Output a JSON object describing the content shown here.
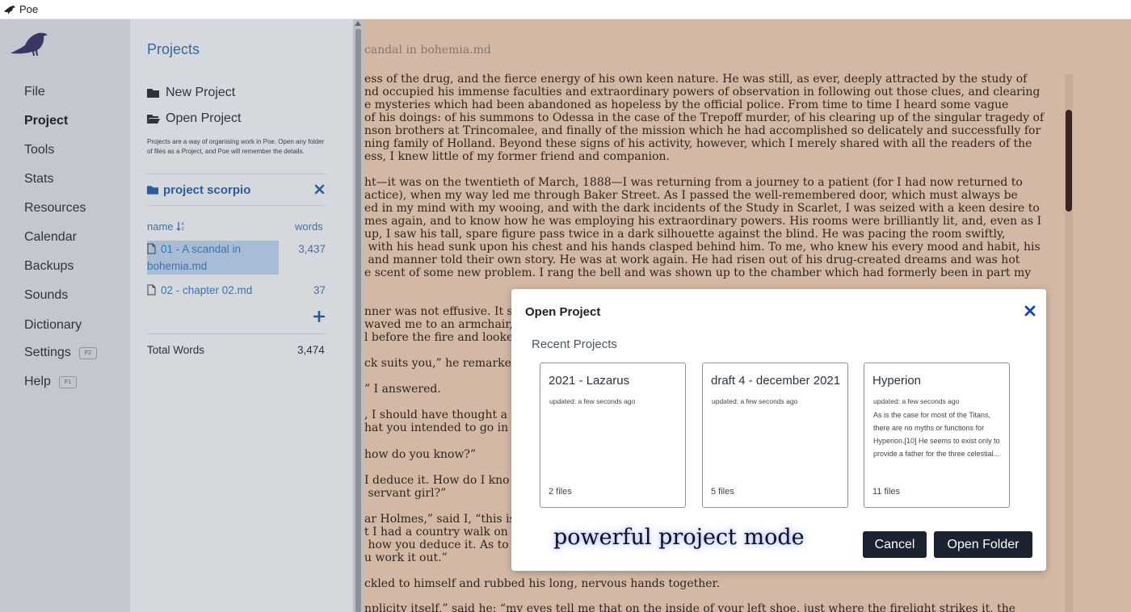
{
  "window": {
    "title": "Poe"
  },
  "nav": {
    "items": [
      {
        "label": "File"
      },
      {
        "label": "Project",
        "active": true
      },
      {
        "label": "Tools"
      },
      {
        "label": "Stats"
      },
      {
        "label": "Resources"
      },
      {
        "label": "Calendar"
      },
      {
        "label": "Backups"
      },
      {
        "label": "Sounds"
      },
      {
        "label": "Dictionary"
      },
      {
        "label": "Settings",
        "shortcut": "F2"
      },
      {
        "label": "Help",
        "shortcut": "F1"
      }
    ]
  },
  "projects_panel": {
    "title": "Projects",
    "new_project": "New Project",
    "open_project": "Open Project",
    "description": "Projects are a way of organising work in Poe. Open any folder of files as a Project, and Poe will remember the details.",
    "current_project": "project scorpio",
    "col_name": "name",
    "col_words": "words",
    "files": [
      {
        "name": "01 - A scandal in bohemia.md",
        "words": "3,437",
        "selected": true
      },
      {
        "name": "02 - chapter 02.md",
        "words": "37"
      }
    ],
    "total_label": "Total Words",
    "total_value": "3,474"
  },
  "editor": {
    "doc_title": "candal in bohemia.md",
    "para1": [
      "ess of the drug, and the fierce energy of his own keen nature. He was still, as ever, deeply attracted by the study of",
      "nd occupied his immense faculties and extraordinary powers of observation in following out those clues, and clearing",
      "e mysteries which had been abandoned as hopeless by the official police. From time to time I heard some vague",
      "of his doings: of his summons to Odessa in the case of the Trepoff murder, of his clearing up of the singular tragedy of",
      "nson brothers at Trincomalee, and finally of the mission which he had accomplished so delicately and successfully for",
      "ning family of Holland. Beyond these signs of his activity, however, which I merely shared with all the readers of the",
      "ess, I knew little of my former friend and companion."
    ],
    "para2": [
      "ht—it was on the twentieth of March, 1888—I was returning from a journey to a patient (for I had now returned to",
      "actice), when my way led me through Baker Street. As I passed the well-remembered door, which must always be",
      "ed in my mind with my wooing, and with the dark incidents of the Study in Scarlet, I was seized with a keen desire to",
      "mes again, and to know how he was employing his extraordinary powers. His rooms were brilliantly lit, and, even as I",
      "up, I saw his tall, spare figure pass twice in a dark silhouette against the blind. He was pacing the room swiftly,",
      " with his head sunk upon his chest and his hands clasped behind him. To me, who knew his every mood and habit, his",
      " and manner told their own story. He was at work again. He had risen out of his drug-created dreams and was hot",
      "e scent of some new problem. I rang the bell and was shown up to the chamber which had formerly been in part my"
    ],
    "para3": [
      "nner was not effusive. It se",
      "waved me to an armchair,",
      "l before the fire and looke"
    ],
    "para4": "ck suits you,” he remarke",
    "para5": "” I answered.",
    "para6": [
      ", I should have thought a",
      "hat you intended to go in"
    ],
    "para7": "how do you know?”",
    "para8": [
      "I deduce it. How do I kno",
      " servant girl?”"
    ],
    "para9": [
      "ar Holmes,” said I, “this is",
      "t I had a country walk on",
      " how you deduce it. As to",
      "u work it out.”"
    ],
    "para10": "ckled to himself and rubbed his long, nervous hands together.",
    "para11": "nplicity itself,” said he; “my eyes tell me that on the inside of your left shoe, just where the firelight strikes it, the"
  },
  "modal": {
    "title": "Open Project",
    "recent_label": "Recent Projects",
    "cards": [
      {
        "title": "2021 - Lazarus",
        "updated": "updated: a few seconds ago",
        "desc": "",
        "files": "2 files"
      },
      {
        "title": "draft 4 - december 2021",
        "updated": "updated: a few seconds ago",
        "desc": "",
        "files": "5 files"
      },
      {
        "title": "Hyperion",
        "updated": "updated: a few seconds ago",
        "desc": "As is the case for most of the Titans, there are no myths or functions for Hyperion.[10] He seems to exist only to provide a father for the three celestial...",
        "files": "11 files"
      }
    ],
    "cancel_label": "Cancel",
    "open_folder_label": "Open Folder"
  },
  "caption": "powerful project mode",
  "colors": {
    "accent": "#2b5c9a",
    "close_x": "#1440b8",
    "button_dark": "#1b2230",
    "editor_bg": "#d3b8a5"
  },
  "icons": [
    "raven-logo-icon",
    "folder-icon",
    "folder-open-icon",
    "sort-icon",
    "document-icon",
    "plus-icon",
    "close-icon"
  ]
}
